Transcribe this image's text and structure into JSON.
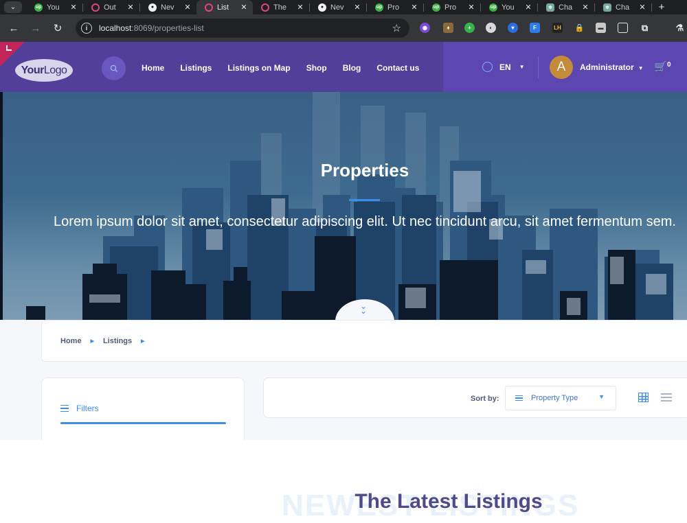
{
  "browser": {
    "tabs": [
      {
        "label": "You",
        "favicon": "upwork"
      },
      {
        "label": "Out",
        "favicon": "ring"
      },
      {
        "label": "Nev",
        "favicon": "github"
      },
      {
        "label": "List",
        "favicon": "ring",
        "active": true
      },
      {
        "label": "The",
        "favicon": "ring"
      },
      {
        "label": "Nev",
        "favicon": "github"
      },
      {
        "label": "Pro",
        "favicon": "upwork"
      },
      {
        "label": "Pro",
        "favicon": "upwork"
      },
      {
        "label": "You",
        "favicon": "upwork"
      },
      {
        "label": "Cha",
        "favicon": "chatgpt"
      },
      {
        "label": "Cha",
        "favicon": "chatgpt"
      }
    ],
    "url_host": "localhost",
    "url_path": ":8069/properties-list"
  },
  "header": {
    "logo_bold": "Your",
    "logo_light": "Logo",
    "menu": [
      "Home",
      "Listings",
      "Listings on Map",
      "Shop",
      "Blog",
      "Contact us"
    ],
    "language": "EN",
    "avatar_letter": "A",
    "user_name": "Administrator",
    "cart_count": "0",
    "colors": {
      "header_bg": "#513f99",
      "header_right_bg": "#5c46b0",
      "accent": "#3b8de8"
    }
  },
  "hero": {
    "title": "Properties",
    "subtitle": "Lorem ipsum dolor sit amet, consectetur adipiscing elit. Ut nec tincidunt arcu, sit amet fermentum sem."
  },
  "breadcrumb": [
    "Home",
    "Listings"
  ],
  "filters": {
    "label": "Filters"
  },
  "sort": {
    "label": "Sort by:",
    "selected": "Property Type"
  },
  "section": {
    "title": "The Latest Listings",
    "ghost_text": "NEWEST LISTINGS"
  }
}
